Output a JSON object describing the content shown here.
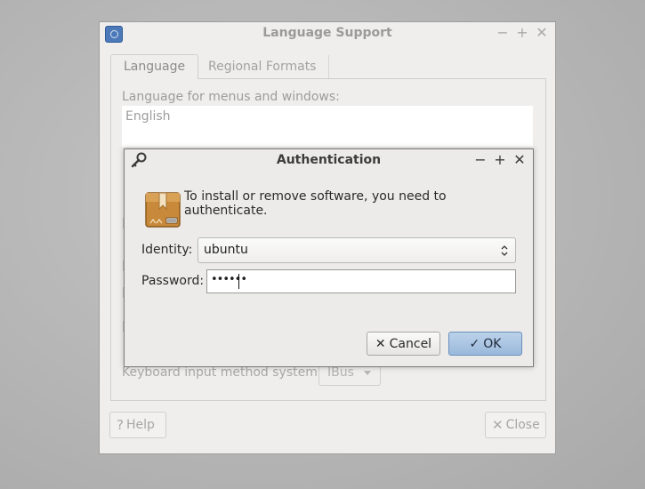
{
  "language_window": {
    "title": "Language Support",
    "tabs": [
      {
        "label": "Language"
      },
      {
        "label": "Regional Formats"
      }
    ],
    "language_label": "Language for menus and windows:",
    "languages": [
      "English"
    ],
    "keyboard_label": "Keyboard input method system:",
    "keyboard_value": "IBus",
    "help_label": "Help",
    "close_label": "Close",
    "wm": {
      "minimize": "−",
      "maximize": "+",
      "close": "✕"
    }
  },
  "auth_dialog": {
    "title": "Authentication",
    "message": "To install or remove software, you need to authenticate.",
    "identity_label": "Identity:",
    "identity_value": "ubuntu",
    "password_label": "Password:",
    "password_value": "••••••",
    "cancel_label": "Cancel",
    "ok_label": "OK",
    "wm": {
      "minimize": "−",
      "maximize": "+",
      "close": "✕"
    }
  },
  "icons": {
    "app": "language-support-icon",
    "auth_key": "key-icon",
    "package": "package-icon",
    "help": "question-icon",
    "close": "x-icon",
    "cancel": "x-icon",
    "ok": "check-icon"
  },
  "colors": {
    "ok_button": "#9ab8dc",
    "window_bg": "#efeeec",
    "desktop_bg": "#b4b4b4"
  }
}
